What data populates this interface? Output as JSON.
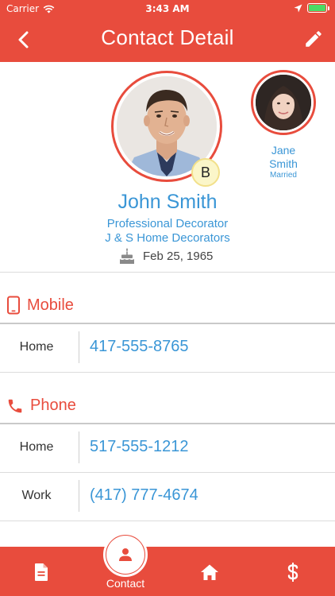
{
  "status_bar": {
    "carrier": "Carrier",
    "time": "3:43 AM"
  },
  "header": {
    "title": "Contact Detail",
    "back_icon": "back-chevron-icon",
    "edit_icon": "pencil-icon"
  },
  "profile": {
    "name": "John Smith",
    "job_title": "Professional Decorator",
    "company": "J & S Home Decorators",
    "birthday": "Feb 25, 1965",
    "badge": "B"
  },
  "spouse": {
    "first_name": "Jane",
    "last_name": "Smith",
    "status": "Married"
  },
  "mobile": {
    "title": "Mobile",
    "rows": [
      {
        "label": "Home",
        "value": "417-555-8765"
      }
    ]
  },
  "phone": {
    "title": "Phone",
    "rows": [
      {
        "label": "Home",
        "value": "517-555-1212"
      },
      {
        "label": "Work",
        "value": "(417) 777-4674"
      }
    ]
  },
  "bottom_nav": {
    "contact_label": "Contact"
  },
  "colors": {
    "accent": "#e84c3d",
    "link": "#3a96d6"
  }
}
